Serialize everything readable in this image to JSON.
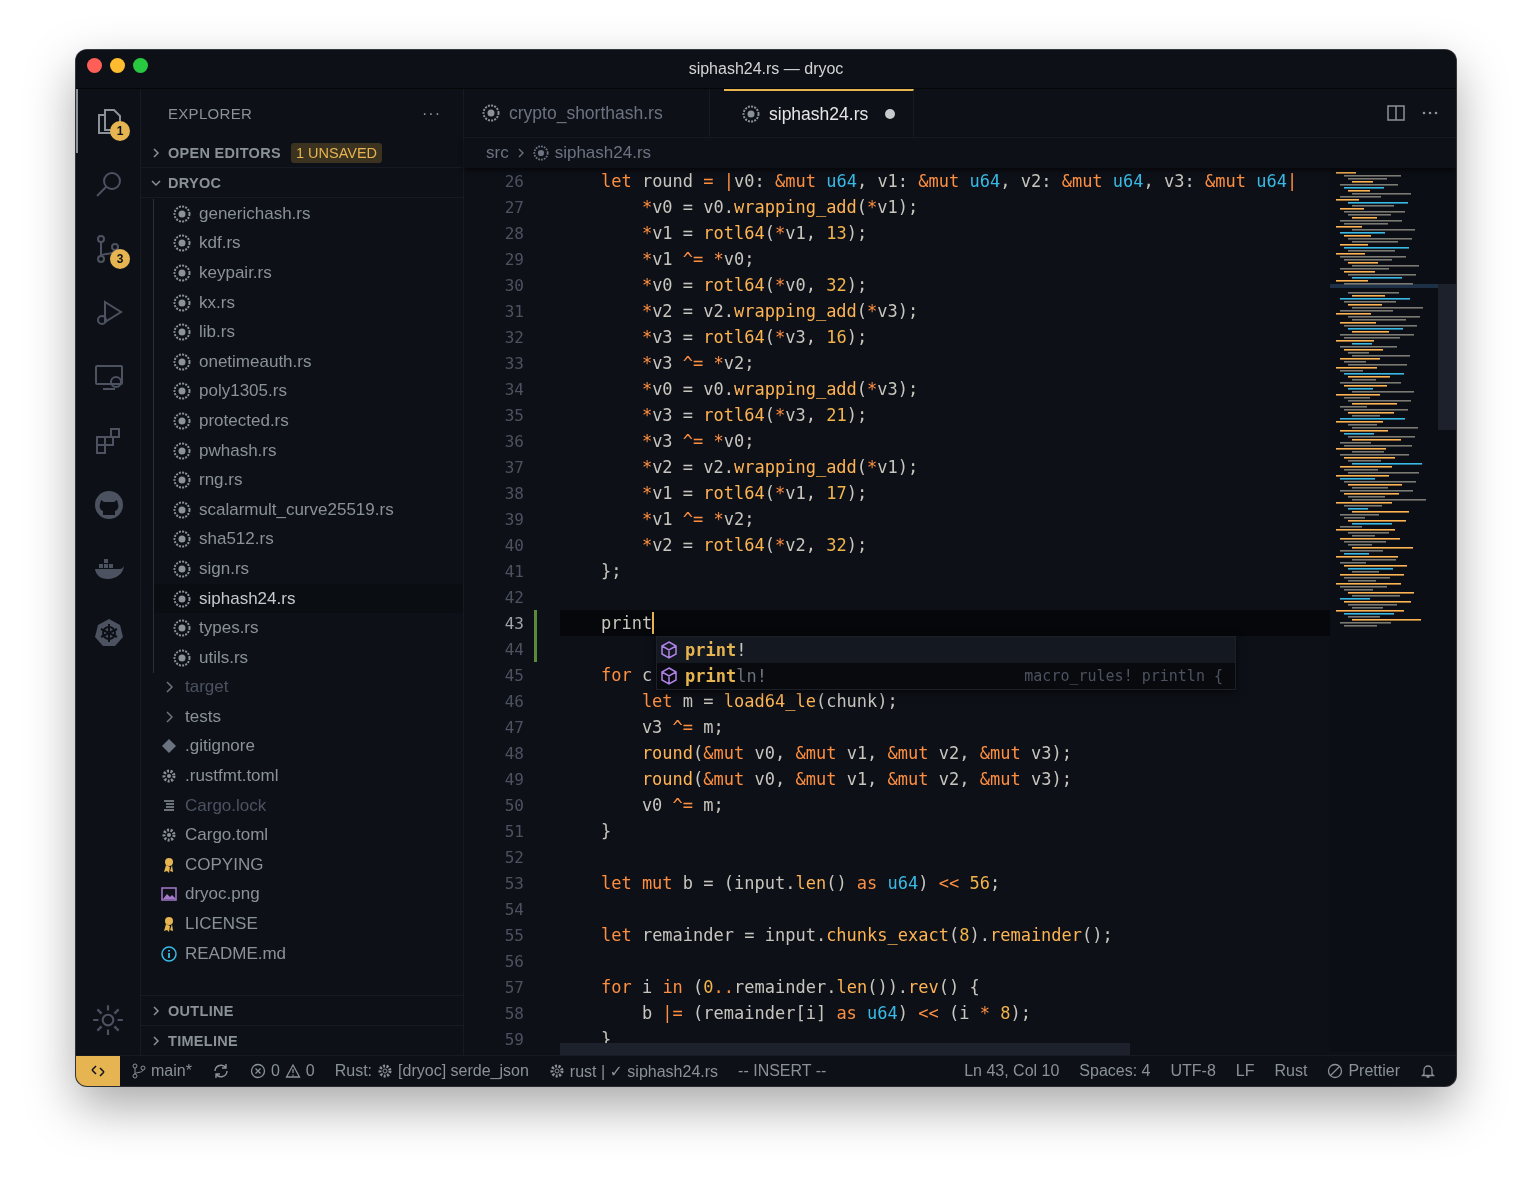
{
  "window": {
    "title": "siphash24.rs — dryoc"
  },
  "activity_bar": {
    "items": [
      {
        "kind": "files",
        "badge": "1",
        "selected": true
      },
      {
        "kind": "search",
        "selected": false
      },
      {
        "kind": "source-control",
        "badge": "3",
        "selected": false
      },
      {
        "kind": "run",
        "selected": false
      },
      {
        "kind": "remote",
        "selected": false
      },
      {
        "kind": "extensions",
        "selected": false
      },
      {
        "kind": "github",
        "selected": false
      },
      {
        "kind": "docker",
        "selected": false
      },
      {
        "kind": "wheel",
        "selected": false
      }
    ],
    "bottom": [
      {
        "kind": "settings"
      }
    ]
  },
  "sidebar": {
    "title": "EXPLORER",
    "more": "···",
    "sections": [
      {
        "label": "OPEN EDITORS",
        "expanded": false,
        "badge": "1 UNSAVED"
      }
    ],
    "project": {
      "label": "DRYOC",
      "expanded": true,
      "children": [
        {
          "kind": "folder-contents",
          "children": [
            {
              "label": "generichash.rs",
              "kind": "rust",
              "selected": false,
              "dimmed": false
            },
            {
              "label": "kdf.rs",
              "kind": "rust",
              "selected": false,
              "dimmed": false
            },
            {
              "label": "keypair.rs",
              "kind": "rust",
              "selected": false,
              "dimmed": false
            },
            {
              "label": "kx.rs",
              "kind": "rust",
              "selected": false,
              "dimmed": false
            },
            {
              "label": "lib.rs",
              "kind": "rust",
              "selected": false,
              "dimmed": false
            },
            {
              "label": "onetimeauth.rs",
              "kind": "rust",
              "selected": false,
              "dimmed": false
            },
            {
              "label": "poly1305.rs",
              "kind": "rust",
              "selected": false,
              "dimmed": false
            },
            {
              "label": "protected.rs",
              "kind": "rust",
              "selected": false,
              "dimmed": false
            },
            {
              "label": "pwhash.rs",
              "kind": "rust",
              "selected": false,
              "dimmed": false
            },
            {
              "label": "rng.rs",
              "kind": "rust",
              "selected": false,
              "dimmed": false
            },
            {
              "label": "scalarmult_curve25519.rs",
              "kind": "rust",
              "selected": false,
              "dimmed": false
            },
            {
              "label": "sha512.rs",
              "kind": "rust",
              "selected": false,
              "dimmed": false
            },
            {
              "label": "sign.rs",
              "kind": "rust",
              "selected": false,
              "dimmed": false
            },
            {
              "label": "siphash24.rs",
              "kind": "rust",
              "selected": true,
              "dimmed": false
            },
            {
              "label": "types.rs",
              "kind": "rust",
              "selected": false,
              "dimmed": false
            },
            {
              "label": "utils.rs",
              "kind": "rust",
              "selected": false,
              "dimmed": false
            }
          ]
        },
        {
          "label": "target",
          "kind": "folder",
          "selected": false,
          "dimmed": true
        },
        {
          "label": "tests",
          "kind": "folder",
          "selected": false,
          "dimmed": false
        },
        {
          "label": ".gitignore",
          "kind": "git",
          "selected": false,
          "dimmed": false
        },
        {
          "label": ".rustfmt.toml",
          "kind": "config",
          "selected": false,
          "dimmed": false
        },
        {
          "label": "Cargo.lock",
          "kind": "lines",
          "selected": false,
          "dimmed": true
        },
        {
          "label": "Cargo.toml",
          "kind": "config",
          "selected": false,
          "dimmed": false
        },
        {
          "label": "COPYING",
          "kind": "license",
          "selected": false,
          "dimmed": false
        },
        {
          "label": "dryoc.png",
          "kind": "image",
          "selected": false,
          "dimmed": false
        },
        {
          "label": "LICENSE",
          "kind": "license",
          "selected": false,
          "dimmed": false
        },
        {
          "label": "README.md",
          "kind": "info",
          "selected": false,
          "dimmed": false
        }
      ]
    },
    "footer_sections": [
      {
        "label": "OUTLINE",
        "expanded": false
      },
      {
        "label": "TIMELINE",
        "expanded": false
      }
    ]
  },
  "tabs": [
    {
      "label": "crypto_shorthash.rs",
      "selected": false,
      "dirty": false
    },
    {
      "label": "siphash24.rs",
      "selected": true,
      "dirty": true
    }
  ],
  "breadcrumb": [
    "src",
    "siphash24.rs"
  ],
  "editor": {
    "lines": [
      {
        "n": "26",
        "current": false,
        "added": false,
        "tokens": [
          {
            "text": "    let",
            "kind": "kw"
          },
          {
            "text": " round ",
            "kind": "p"
          },
          {
            "text": "=",
            "kind": "op"
          },
          {
            "text": " |",
            "kind": "op"
          },
          {
            "text": "v0: ",
            "kind": "p"
          },
          {
            "text": "&mut",
            "kind": "kw"
          },
          {
            "text": " u64",
            "kind": "ty"
          },
          {
            "text": ", v1: ",
            "kind": "p"
          },
          {
            "text": "&mut",
            "kind": "kw"
          },
          {
            "text": " u64",
            "kind": "ty"
          },
          {
            "text": ", v2: ",
            "kind": "p"
          },
          {
            "text": "&mut",
            "kind": "kw"
          },
          {
            "text": " u64",
            "kind": "ty"
          },
          {
            "text": ", v3: ",
            "kind": "p"
          },
          {
            "text": "&mut",
            "kind": "kw"
          },
          {
            "text": " u64",
            "kind": "ty"
          },
          {
            "text": "|",
            "kind": "op"
          }
        ]
      },
      {
        "n": "27",
        "current": false,
        "added": false,
        "tokens": [
          {
            "text": "        *",
            "kind": "op"
          },
          {
            "text": "v0 = v0.",
            "kind": "p"
          },
          {
            "text": "wrapping_add",
            "kind": "fn"
          },
          {
            "text": "(",
            "kind": "p"
          },
          {
            "text": "*",
            "kind": "op"
          },
          {
            "text": "v1);",
            "kind": "p"
          }
        ]
      },
      {
        "n": "28",
        "current": false,
        "added": false,
        "tokens": [
          {
            "text": "        *",
            "kind": "op"
          },
          {
            "text": "v1 = ",
            "kind": "p"
          },
          {
            "text": "rotl64",
            "kind": "fn"
          },
          {
            "text": "(",
            "kind": "p"
          },
          {
            "text": "*",
            "kind": "op"
          },
          {
            "text": "v1, ",
            "kind": "p"
          },
          {
            "text": "13",
            "kind": "num"
          },
          {
            "text": ");",
            "kind": "p"
          }
        ]
      },
      {
        "n": "29",
        "current": false,
        "added": false,
        "tokens": [
          {
            "text": "        *",
            "kind": "op"
          },
          {
            "text": "v1 ",
            "kind": "p"
          },
          {
            "text": "^=",
            "kind": "op"
          },
          {
            "text": " *",
            "kind": "op"
          },
          {
            "text": "v0;",
            "kind": "p"
          }
        ]
      },
      {
        "n": "30",
        "current": false,
        "added": false,
        "tokens": [
          {
            "text": "        *",
            "kind": "op"
          },
          {
            "text": "v0 = ",
            "kind": "p"
          },
          {
            "text": "rotl64",
            "kind": "fn"
          },
          {
            "text": "(",
            "kind": "p"
          },
          {
            "text": "*",
            "kind": "op"
          },
          {
            "text": "v0, ",
            "kind": "p"
          },
          {
            "text": "32",
            "kind": "num"
          },
          {
            "text": ");",
            "kind": "p"
          }
        ]
      },
      {
        "n": "31",
        "current": false,
        "added": false,
        "tokens": [
          {
            "text": "        *",
            "kind": "op"
          },
          {
            "text": "v2 = v2.",
            "kind": "p"
          },
          {
            "text": "wrapping_add",
            "kind": "fn"
          },
          {
            "text": "(",
            "kind": "p"
          },
          {
            "text": "*",
            "kind": "op"
          },
          {
            "text": "v3);",
            "kind": "p"
          }
        ]
      },
      {
        "n": "32",
        "current": false,
        "added": false,
        "tokens": [
          {
            "text": "        *",
            "kind": "op"
          },
          {
            "text": "v3 = ",
            "kind": "p"
          },
          {
            "text": "rotl64",
            "kind": "fn"
          },
          {
            "text": "(",
            "kind": "p"
          },
          {
            "text": "*",
            "kind": "op"
          },
          {
            "text": "v3, ",
            "kind": "p"
          },
          {
            "text": "16",
            "kind": "num"
          },
          {
            "text": ");",
            "kind": "p"
          }
        ]
      },
      {
        "n": "33",
        "current": false,
        "added": false,
        "tokens": [
          {
            "text": "        *",
            "kind": "op"
          },
          {
            "text": "v3 ",
            "kind": "p"
          },
          {
            "text": "^=",
            "kind": "op"
          },
          {
            "text": " *",
            "kind": "op"
          },
          {
            "text": "v2;",
            "kind": "p"
          }
        ]
      },
      {
        "n": "34",
        "current": false,
        "added": false,
        "tokens": [
          {
            "text": "        *",
            "kind": "op"
          },
          {
            "text": "v0 = v0.",
            "kind": "p"
          },
          {
            "text": "wrapping_add",
            "kind": "fn"
          },
          {
            "text": "(",
            "kind": "p"
          },
          {
            "text": "*",
            "kind": "op"
          },
          {
            "text": "v3);",
            "kind": "p"
          }
        ]
      },
      {
        "n": "35",
        "current": false,
        "added": false,
        "tokens": [
          {
            "text": "        *",
            "kind": "op"
          },
          {
            "text": "v3 = ",
            "kind": "p"
          },
          {
            "text": "rotl64",
            "kind": "fn"
          },
          {
            "text": "(",
            "kind": "p"
          },
          {
            "text": "*",
            "kind": "op"
          },
          {
            "text": "v3, ",
            "kind": "p"
          },
          {
            "text": "21",
            "kind": "num"
          },
          {
            "text": ");",
            "kind": "p"
          }
        ]
      },
      {
        "n": "36",
        "current": false,
        "added": false,
        "tokens": [
          {
            "text": "        *",
            "kind": "op"
          },
          {
            "text": "v3 ",
            "kind": "p"
          },
          {
            "text": "^=",
            "kind": "op"
          },
          {
            "text": " *",
            "kind": "op"
          },
          {
            "text": "v0;",
            "kind": "p"
          }
        ]
      },
      {
        "n": "37",
        "current": false,
        "added": false,
        "tokens": [
          {
            "text": "        *",
            "kind": "op"
          },
          {
            "text": "v2 = v2.",
            "kind": "p"
          },
          {
            "text": "wrapping_add",
            "kind": "fn"
          },
          {
            "text": "(",
            "kind": "p"
          },
          {
            "text": "*",
            "kind": "op"
          },
          {
            "text": "v1);",
            "kind": "p"
          }
        ]
      },
      {
        "n": "38",
        "current": false,
        "added": false,
        "tokens": [
          {
            "text": "        *",
            "kind": "op"
          },
          {
            "text": "v1 = ",
            "kind": "p"
          },
          {
            "text": "rotl64",
            "kind": "fn"
          },
          {
            "text": "(",
            "kind": "p"
          },
          {
            "text": "*",
            "kind": "op"
          },
          {
            "text": "v1, ",
            "kind": "p"
          },
          {
            "text": "17",
            "kind": "num"
          },
          {
            "text": ");",
            "kind": "p"
          }
        ]
      },
      {
        "n": "39",
        "current": false,
        "added": false,
        "tokens": [
          {
            "text": "        *",
            "kind": "op"
          },
          {
            "text": "v1 ",
            "kind": "p"
          },
          {
            "text": "^=",
            "kind": "op"
          },
          {
            "text": " *",
            "kind": "op"
          },
          {
            "text": "v2;",
            "kind": "p"
          }
        ]
      },
      {
        "n": "40",
        "current": false,
        "added": false,
        "tokens": [
          {
            "text": "        *",
            "kind": "op"
          },
          {
            "text": "v2 = ",
            "kind": "p"
          },
          {
            "text": "rotl64",
            "kind": "fn"
          },
          {
            "text": "(",
            "kind": "p"
          },
          {
            "text": "*",
            "kind": "op"
          },
          {
            "text": "v2, ",
            "kind": "p"
          },
          {
            "text": "32",
            "kind": "num"
          },
          {
            "text": ");",
            "kind": "p"
          }
        ]
      },
      {
        "n": "41",
        "current": false,
        "added": false,
        "tokens": [
          {
            "text": "    };",
            "kind": "p"
          }
        ]
      },
      {
        "n": "42",
        "current": false,
        "added": false
      },
      {
        "n": "43",
        "current": true,
        "added": true,
        "tokens": [
          {
            "text": "    print",
            "kind": "p"
          }
        ]
      },
      {
        "n": "44",
        "current": false,
        "added": true
      },
      {
        "n": "45",
        "current": false,
        "added": false,
        "tokens": [
          {
            "text": "    for",
            "kind": "kw"
          },
          {
            "text": " c",
            "kind": "p"
          }
        ]
      },
      {
        "n": "46",
        "current": false,
        "added": false,
        "tokens": [
          {
            "text": "        let",
            "kind": "kw"
          },
          {
            "text": " m = ",
            "kind": "p"
          },
          {
            "text": "load64_le",
            "kind": "fn"
          },
          {
            "text": "(chunk);",
            "kind": "p"
          }
        ]
      },
      {
        "n": "47",
        "current": false,
        "added": false,
        "tokens": [
          {
            "text": "        v3 ",
            "kind": "p"
          },
          {
            "text": "^=",
            "kind": "op"
          },
          {
            "text": " m;",
            "kind": "p"
          }
        ]
      },
      {
        "n": "48",
        "current": false,
        "added": false,
        "tokens": [
          {
            "text": "        round",
            "kind": "fn"
          },
          {
            "text": "(",
            "kind": "p"
          },
          {
            "text": "&mut",
            "kind": "kw"
          },
          {
            "text": " v0, ",
            "kind": "p"
          },
          {
            "text": "&mut",
            "kind": "kw"
          },
          {
            "text": " v1, ",
            "kind": "p"
          },
          {
            "text": "&mut",
            "kind": "kw"
          },
          {
            "text": " v2, ",
            "kind": "p"
          },
          {
            "text": "&mut",
            "kind": "kw"
          },
          {
            "text": " v3);",
            "kind": "p"
          }
        ]
      },
      {
        "n": "49",
        "current": false,
        "added": false,
        "tokens": [
          {
            "text": "        round",
            "kind": "fn"
          },
          {
            "text": "(",
            "kind": "p"
          },
          {
            "text": "&mut",
            "kind": "kw"
          },
          {
            "text": " v0, ",
            "kind": "p"
          },
          {
            "text": "&mut",
            "kind": "kw"
          },
          {
            "text": " v1, ",
            "kind": "p"
          },
          {
            "text": "&mut",
            "kind": "kw"
          },
          {
            "text": " v2, ",
            "kind": "p"
          },
          {
            "text": "&mut",
            "kind": "kw"
          },
          {
            "text": " v3);",
            "kind": "p"
          }
        ]
      },
      {
        "n": "50",
        "current": false,
        "added": false,
        "tokens": [
          {
            "text": "        v0 ",
            "kind": "p"
          },
          {
            "text": "^=",
            "kind": "op"
          },
          {
            "text": " m;",
            "kind": "p"
          }
        ]
      },
      {
        "n": "51",
        "current": false,
        "added": false,
        "tokens": [
          {
            "text": "    }",
            "kind": "p"
          }
        ]
      },
      {
        "n": "52",
        "current": false,
        "added": false
      },
      {
        "n": "53",
        "current": false,
        "added": false,
        "tokens": [
          {
            "text": "    let mut",
            "kind": "kw"
          },
          {
            "text": " b = (input.",
            "kind": "p"
          },
          {
            "text": "len",
            "kind": "fn"
          },
          {
            "text": "() ",
            "kind": "p"
          },
          {
            "text": "as",
            "kind": "kw"
          },
          {
            "text": " u64",
            "kind": "ty"
          },
          {
            "text": ") ",
            "kind": "p"
          },
          {
            "text": "<<",
            "kind": "op"
          },
          {
            "text": " 56",
            "kind": "num"
          },
          {
            "text": ";",
            "kind": "p"
          }
        ]
      },
      {
        "n": "54",
        "current": false,
        "added": false
      },
      {
        "n": "55",
        "current": false,
        "added": false,
        "tokens": [
          {
            "text": "    let",
            "kind": "kw"
          },
          {
            "text": " remainder = input.",
            "kind": "p"
          },
          {
            "text": "chunks_exact",
            "kind": "fn"
          },
          {
            "text": "(",
            "kind": "p"
          },
          {
            "text": "8",
            "kind": "num"
          },
          {
            "text": ").",
            "kind": "p"
          },
          {
            "text": "remainder",
            "kind": "fn"
          },
          {
            "text": "();",
            "kind": "p"
          }
        ]
      },
      {
        "n": "56",
        "current": false,
        "added": false
      },
      {
        "n": "57",
        "current": false,
        "added": false,
        "tokens": [
          {
            "text": "    for",
            "kind": "kw"
          },
          {
            "text": " i ",
            "kind": "p"
          },
          {
            "text": "in",
            "kind": "kw"
          },
          {
            "text": " (",
            "kind": "p"
          },
          {
            "text": "0",
            "kind": "num"
          },
          {
            "text": "..",
            "kind": "op"
          },
          {
            "text": "remainder.",
            "kind": "p"
          },
          {
            "text": "len",
            "kind": "fn"
          },
          {
            "text": "()).",
            "kind": "p"
          },
          {
            "text": "rev",
            "kind": "fn"
          },
          {
            "text": "() {",
            "kind": "p"
          }
        ]
      },
      {
        "n": "58",
        "current": false,
        "added": false,
        "tokens": [
          {
            "text": "        b ",
            "kind": "p"
          },
          {
            "text": "|=",
            "kind": "op"
          },
          {
            "text": " (remainder[i] ",
            "kind": "p"
          },
          {
            "text": "as",
            "kind": "kw"
          },
          {
            "text": " u64",
            "kind": "ty"
          },
          {
            "text": ") ",
            "kind": "p"
          },
          {
            "text": "<<",
            "kind": "op"
          },
          {
            "text": " (i ",
            "kind": "p"
          },
          {
            "text": "*",
            "kind": "op"
          },
          {
            "text": " 8",
            "kind": "num"
          },
          {
            "text": ");",
            "kind": "p"
          }
        ]
      },
      {
        "n": "59",
        "current": false,
        "added": false,
        "tokens": [
          {
            "text": "    }",
            "kind": "p"
          }
        ]
      }
    ],
    "suggestions": [
      {
        "match": "print",
        "rest": "!",
        "selected": false
      },
      {
        "match": "print",
        "rest": "ln!",
        "selected": true,
        "detail": "macro_rules! println {"
      }
    ]
  },
  "status_bar": {
    "left": [
      {
        "kind": "branch",
        "text": "main*"
      },
      {
        "kind": "sync"
      },
      {
        "kind": "problems",
        "errors": "0",
        "warnings": "0"
      },
      {
        "kind": "rust",
        "label": "Rust:",
        "text": "[dryoc] serde_json"
      },
      {
        "kind": "analyzer",
        "text": "rust | ✓ siphash24.rs"
      },
      {
        "kind": "plain",
        "text": "-- INSERT --"
      }
    ],
    "right": [
      {
        "kind": "plain",
        "text": "Ln 43, Col 10"
      },
      {
        "kind": "plain",
        "text": "Spaces: 4"
      },
      {
        "kind": "plain",
        "text": "UTF-8"
      },
      {
        "kind": "plain",
        "text": "LF"
      },
      {
        "kind": "plain",
        "text": "Rust"
      },
      {
        "kind": "prettier",
        "text": "Prettier"
      },
      {
        "kind": "bell"
      }
    ]
  }
}
